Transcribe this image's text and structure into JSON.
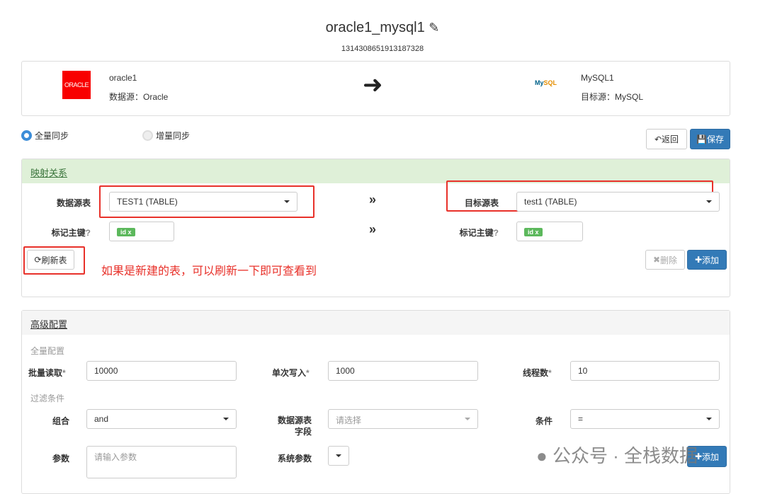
{
  "header": {
    "title": "oracle1_mysql1",
    "id": "1314308651913187328"
  },
  "source": {
    "logo": "ORACLE",
    "name": "oracle1",
    "type_label": "数据源：Oracle"
  },
  "target": {
    "logo": "MySQL",
    "name": "MySQL1",
    "type_label": "目标源：MySQL"
  },
  "sync": {
    "full": "全量同步",
    "incremental": "增量同步",
    "selected": "full"
  },
  "toolbar": {
    "back": "返回",
    "save": "保存"
  },
  "mapping": {
    "title": "映射关系",
    "source_table_label": "数据源表",
    "source_table": "TEST1 (TABLE)",
    "target_table_label": "目标源表",
    "target_table": "test1 (TABLE)",
    "pk_label": "标记主键",
    "source_pk_tag": "id",
    "target_pk_tag": "id",
    "tag_remove": "x",
    "refresh": "刷新表",
    "delete": "删除",
    "add": "添加",
    "annotation": "如果是新建的表，可以刷新一下即可查看到"
  },
  "advanced": {
    "title": "高级配置",
    "full_config": "全量配置",
    "batch_read_label": "批量读取",
    "batch_read": "10000",
    "single_write_label": "单次写入",
    "single_write": "1000",
    "threads_label": "线程数",
    "threads": "10",
    "filter": "过滤条件",
    "combo_label": "组合",
    "combo": "and",
    "field_label": "数据源表字段",
    "field_placeholder": "请选择",
    "cond_label": "条件",
    "cond": "=",
    "param_label": "参数",
    "param_placeholder": "请输入参数",
    "sys_param_label": "系统参数",
    "add": "添加"
  },
  "watermark": "公众号 · 全栈数据",
  "colors": {
    "primary": "#337ab7",
    "annotation": "#e8312a",
    "panel_green": "#dff0d8"
  }
}
